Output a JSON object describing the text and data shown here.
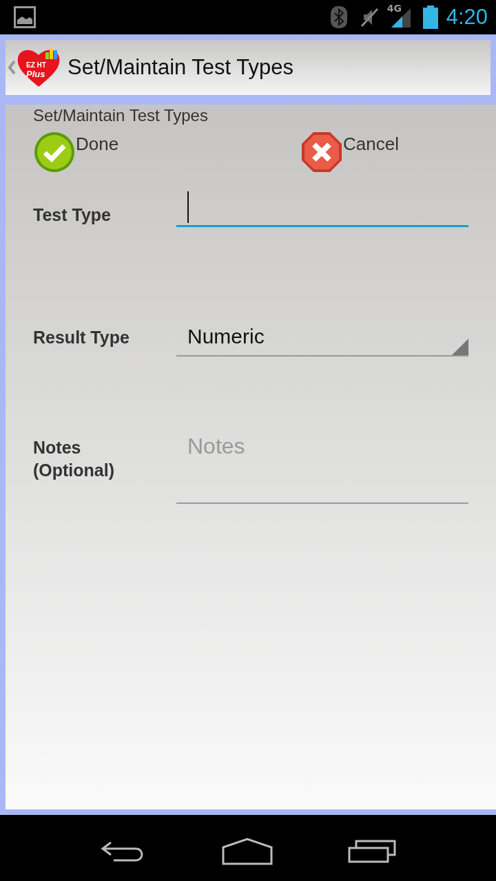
{
  "status_bar": {
    "network": "4G",
    "time": "4:20"
  },
  "action_bar": {
    "logo": {
      "line_1": "EZ HT",
      "line_2": "Plus"
    },
    "title": "Set/Maintain Test Types"
  },
  "form": {
    "heading": "Set/Maintain Test Types",
    "buttons": [
      {
        "kind": "done",
        "label": "Done"
      },
      {
        "kind": "cancel",
        "label": "Cancel"
      }
    ],
    "fields": [
      {
        "kind": "text",
        "label": "Test Type",
        "focused": true
      },
      {
        "kind": "spinner",
        "label": "Result Type",
        "value": "Numeric",
        "focused": false
      },
      {
        "kind": "multiline",
        "label": "Notes (Optional)",
        "placeholder": "Notes",
        "focused": false
      }
    ]
  }
}
